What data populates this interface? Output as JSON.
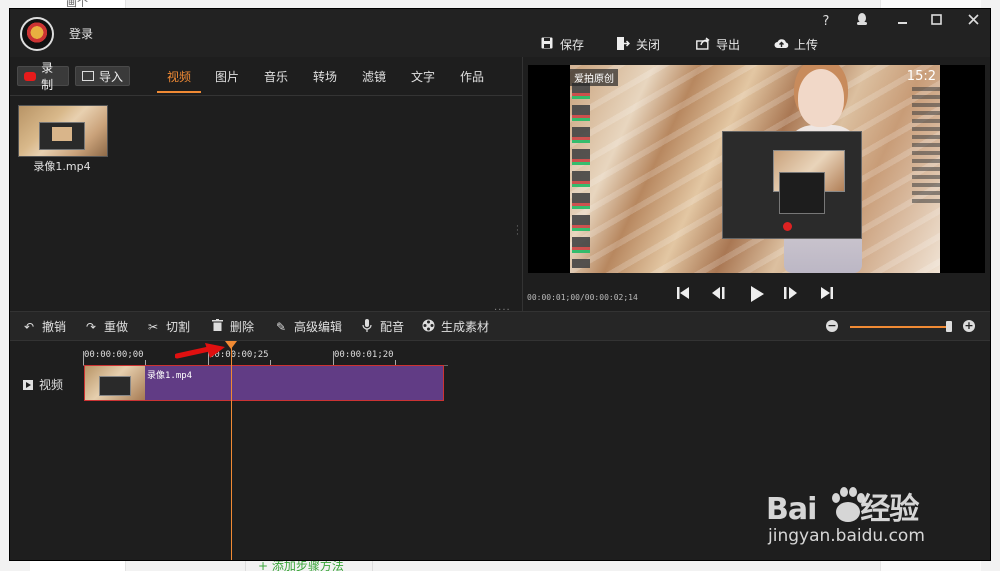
{
  "background": {
    "top_text": "画个",
    "bottom_link": "+ 添加步骤方法"
  },
  "titlebar": {
    "login": "登录"
  },
  "window_controls": {
    "help": "?",
    "skin": "",
    "minimize": "",
    "maximize": "",
    "close": ""
  },
  "top_actions": [
    {
      "label": "保存",
      "icon": "save-icon"
    },
    {
      "label": "关闭",
      "icon": "close-file-icon"
    },
    {
      "label": "导出",
      "icon": "export-icon"
    },
    {
      "label": "上传",
      "icon": "upload-icon"
    }
  ],
  "left_panel": {
    "record_label": "录制",
    "import_label": "导入",
    "tabs": [
      "视频",
      "图片",
      "音乐",
      "转场",
      "滤镜",
      "文字",
      "作品"
    ],
    "active_tab": "视频",
    "media_items": [
      {
        "name": "录像1.mp4"
      }
    ]
  },
  "preview": {
    "time": "00:00:01;00/00:00:02;14",
    "overlay_tag": "爱拍原创",
    "overlay_clock": "15:2"
  },
  "toolbar": {
    "undo": "撤销",
    "redo": "重做",
    "cut": "切割",
    "delete": "删除",
    "advanced_edit": "高级编辑",
    "dub": "配音",
    "generate": "生成素材"
  },
  "zoom": {
    "level": 1.0
  },
  "timeline": {
    "ruler_labels": [
      "00:00:00;00",
      "00:00:00;25",
      "00:00:01;20"
    ],
    "track_label": "视频",
    "clip_name": "录像1.mp4"
  },
  "watermark": {
    "brand": "Bai",
    "brand_tail": "经验",
    "url": "jingyan.baidu.com"
  },
  "colors": {
    "accent": "#f08a34",
    "app_bg": "#1e1e1e",
    "clip": "#613c85",
    "record": "#e81b1b"
  }
}
